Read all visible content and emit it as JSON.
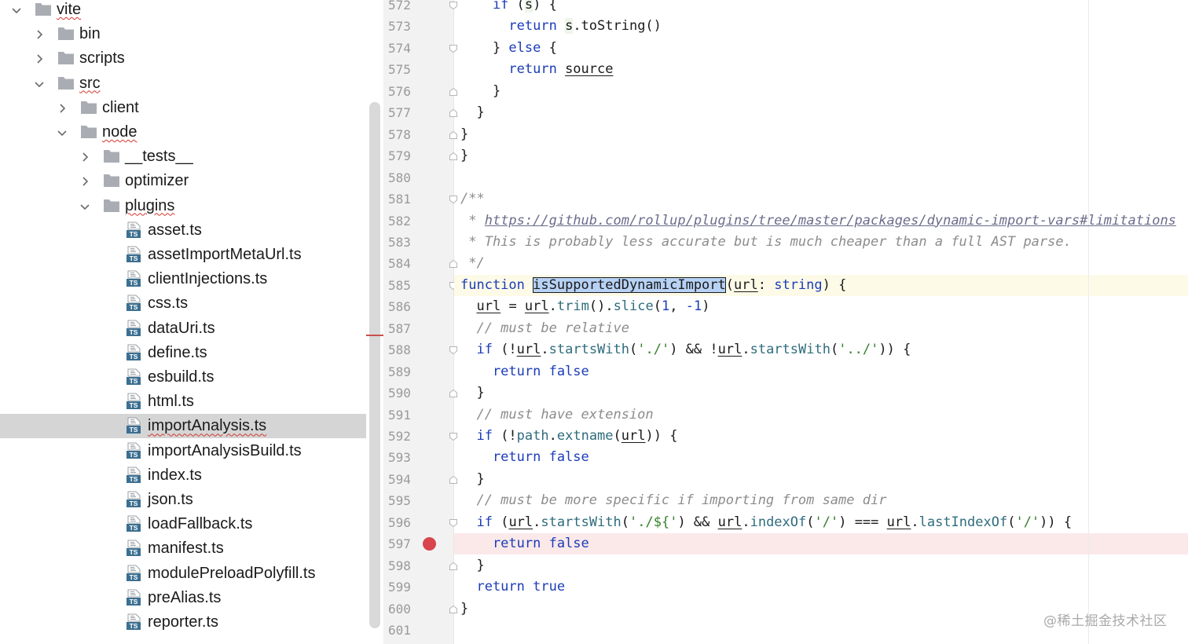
{
  "tree": {
    "rows": [
      {
        "label": "vite",
        "type": "folder",
        "open": true,
        "depth": 0,
        "squiggle": true
      },
      {
        "label": "bin",
        "type": "folder",
        "open": false,
        "depth": 1
      },
      {
        "label": "scripts",
        "type": "folder",
        "open": false,
        "depth": 1
      },
      {
        "label": "src",
        "type": "folder",
        "open": true,
        "depth": 1,
        "squiggle": true
      },
      {
        "label": "client",
        "type": "folder",
        "open": false,
        "depth": 2
      },
      {
        "label": "node",
        "type": "folder",
        "open": true,
        "depth": 2,
        "squiggle": true
      },
      {
        "label": "__tests__",
        "type": "folder",
        "open": false,
        "depth": 3
      },
      {
        "label": "optimizer",
        "type": "folder",
        "open": false,
        "depth": 3
      },
      {
        "label": "plugins",
        "type": "folder",
        "open": true,
        "depth": 3,
        "squiggle": true
      },
      {
        "label": "asset.ts",
        "type": "ts",
        "depth": 4
      },
      {
        "label": "assetImportMetaUrl.ts",
        "type": "ts",
        "depth": 4
      },
      {
        "label": "clientInjections.ts",
        "type": "ts",
        "depth": 4
      },
      {
        "label": "css.ts",
        "type": "ts",
        "depth": 4
      },
      {
        "label": "dataUri.ts",
        "type": "ts",
        "depth": 4
      },
      {
        "label": "define.ts",
        "type": "ts",
        "depth": 4
      },
      {
        "label": "esbuild.ts",
        "type": "ts",
        "depth": 4
      },
      {
        "label": "html.ts",
        "type": "ts",
        "depth": 4
      },
      {
        "label": "importAnalysis.ts",
        "type": "ts",
        "depth": 4,
        "selected": true,
        "squiggle": true
      },
      {
        "label": "importAnalysisBuild.ts",
        "type": "ts",
        "depth": 4
      },
      {
        "label": "index.ts",
        "type": "ts",
        "depth": 4
      },
      {
        "label": "json.ts",
        "type": "ts",
        "depth": 4
      },
      {
        "label": "loadFallback.ts",
        "type": "ts",
        "depth": 4
      },
      {
        "label": "manifest.ts",
        "type": "ts",
        "depth": 4
      },
      {
        "label": "modulePreloadPolyfill.ts",
        "type": "ts",
        "depth": 4
      },
      {
        "label": "preAlias.ts",
        "type": "ts",
        "depth": 4
      },
      {
        "label": "reporter.ts",
        "type": "ts",
        "depth": 4
      }
    ],
    "ts_badge": "TS"
  },
  "editor": {
    "line_numbers": [
      "572",
      "573",
      "574",
      "575",
      "576",
      "577",
      "578",
      "579",
      "580",
      "581",
      "582",
      "583",
      "584",
      "585",
      "586",
      "587",
      "588",
      "589",
      "590",
      "591",
      "592",
      "593",
      "594",
      "595",
      "596",
      "597",
      "598",
      "599",
      "600",
      "601"
    ],
    "caret_line": "585",
    "breakpoint_line": "597",
    "lines": [
      [
        [
          "kw",
          "    if "
        ],
        [
          "",
          "("
        ],
        [
          "sbg",
          "s"
        ],
        [
          "",
          ") {"
        ]
      ],
      [
        [
          "kw",
          "      return "
        ],
        [
          "sbg",
          "s"
        ],
        [
          "",
          ".toString()"
        ]
      ],
      [
        [
          "",
          "    } "
        ],
        [
          "kw",
          "else"
        ],
        [
          "",
          " {"
        ]
      ],
      [
        [
          "kw",
          "      return "
        ],
        [
          "ul",
          "source"
        ]
      ],
      [
        [
          "",
          "    }"
        ]
      ],
      [
        [
          "",
          "  }"
        ]
      ],
      [
        [
          "",
          "}"
        ]
      ],
      [
        [
          "",
          "}"
        ]
      ],
      [
        [
          "",
          ""
        ]
      ],
      [
        [
          "cm",
          "/**"
        ]
      ],
      [
        [
          "cm",
          " * "
        ],
        [
          "link",
          "https://github.com/rollup/plugins/tree/master/packages/dynamic-import-vars#limitations"
        ]
      ],
      [
        [
          "cm",
          " * This is probably less accurate but is much cheaper than a full AST parse."
        ]
      ],
      [
        [
          "cm",
          " */"
        ]
      ],
      [
        [
          "kw",
          "function "
        ],
        [
          "sel",
          "isSupportedDynamicImport"
        ],
        [
          "",
          "("
        ],
        [
          "ul",
          "url"
        ],
        [
          "",
          ": "
        ],
        [
          "kw",
          "string"
        ],
        [
          "",
          ") {"
        ]
      ],
      [
        [
          "",
          "  "
        ],
        [
          "ul",
          "url"
        ],
        [
          "",
          " = "
        ],
        [
          "ul",
          "url"
        ],
        [
          "",
          "."
        ],
        [
          "fn",
          "trim"
        ],
        [
          "",
          "()."
        ],
        [
          "fn",
          "slice"
        ],
        [
          "",
          "("
        ],
        [
          "num",
          "1"
        ],
        [
          "",
          ", "
        ],
        [
          "num",
          "-1"
        ],
        [
          "",
          ")"
        ]
      ],
      [
        [
          "cm",
          "  // must be relative"
        ]
      ],
      [
        [
          "kw",
          "  if "
        ],
        [
          "",
          "(!"
        ],
        [
          "ul",
          "url"
        ],
        [
          "",
          "."
        ],
        [
          "fn",
          "startsWith"
        ],
        [
          "",
          "("
        ],
        [
          "str",
          "'./'"
        ],
        [
          "",
          ") && !"
        ],
        [
          "ul",
          "url"
        ],
        [
          "",
          "."
        ],
        [
          "fn",
          "startsWith"
        ],
        [
          "",
          "("
        ],
        [
          "str",
          "'../'"
        ],
        [
          "",
          ")) {"
        ]
      ],
      [
        [
          "kw",
          "    return false"
        ]
      ],
      [
        [
          "",
          "  }"
        ]
      ],
      [
        [
          "cm",
          "  // must have extension"
        ]
      ],
      [
        [
          "kw",
          "  if "
        ],
        [
          "",
          "(!"
        ],
        [
          "fn",
          "path"
        ],
        [
          "",
          "."
        ],
        [
          "fn",
          "extname"
        ],
        [
          "",
          "("
        ],
        [
          "ul",
          "url"
        ],
        [
          "",
          ")) {"
        ]
      ],
      [
        [
          "kw",
          "    return false"
        ]
      ],
      [
        [
          "",
          "  }"
        ]
      ],
      [
        [
          "cm",
          "  // must be more specific if importing from same dir"
        ]
      ],
      [
        [
          "kw",
          "  if "
        ],
        [
          "",
          "("
        ],
        [
          "ul",
          "url"
        ],
        [
          "",
          "."
        ],
        [
          "fn",
          "startsWith"
        ],
        [
          "",
          "("
        ],
        [
          "str",
          "'./${'"
        ],
        [
          "",
          ") && "
        ],
        [
          "ul",
          "url"
        ],
        [
          "",
          "."
        ],
        [
          "fn",
          "indexOf"
        ],
        [
          "",
          "("
        ],
        [
          "str",
          "'/'"
        ],
        [
          "",
          ") === "
        ],
        [
          "ul",
          "url"
        ],
        [
          "",
          "."
        ],
        [
          "fn",
          "lastIndexOf"
        ],
        [
          "",
          "("
        ],
        [
          "str",
          "'/'"
        ],
        [
          "",
          "))"
        ],
        [
          "",
          " {"
        ]
      ],
      [
        [
          "kw",
          "    return false"
        ]
      ],
      [
        [
          "",
          "  }"
        ]
      ],
      [
        [
          "kw",
          "  return true"
        ]
      ],
      [
        [
          "",
          "}"
        ]
      ],
      [
        [
          "",
          ""
        ]
      ]
    ]
  },
  "watermark": "@稀土掘金技术社区"
}
